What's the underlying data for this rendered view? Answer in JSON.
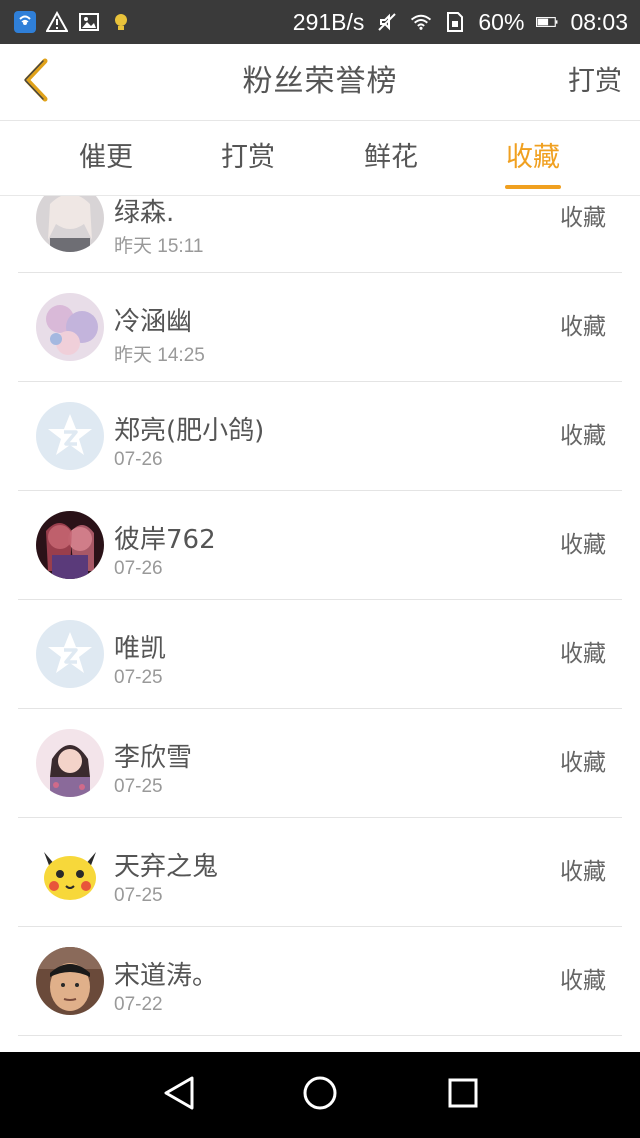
{
  "status_bar": {
    "speed": "291B/s",
    "battery": "60%",
    "time": "08:03"
  },
  "header": {
    "title": "粉丝荣誉榜",
    "right_action": "打赏"
  },
  "tabs": [
    {
      "label": "催更"
    },
    {
      "label": "打赏"
    },
    {
      "label": "鲜花"
    },
    {
      "label": "收藏",
      "active": true
    }
  ],
  "colors": {
    "accent": "#f0a020",
    "status_bar_bg": "#3a3a3a",
    "divider": "#e4e4e4"
  },
  "list": [
    {
      "name": "绿森.",
      "date": "昨天 15:11",
      "action": "收藏",
      "avatar": "photo-girl-icon"
    },
    {
      "name": "冷涵幽",
      "date": "昨天 14:25",
      "action": "收藏",
      "avatar": "anime-art-icon"
    },
    {
      "name": "郑亮(肥小鸽)",
      "date": "07-26",
      "action": "收藏",
      "avatar": "default-qq-star-icon"
    },
    {
      "name": "彼岸762",
      "date": "07-26",
      "action": "收藏",
      "avatar": "anime-girls-icon"
    },
    {
      "name": "唯凯",
      "date": "07-25",
      "action": "收藏",
      "avatar": "default-qq-star-icon"
    },
    {
      "name": "李欣雪",
      "date": "07-25",
      "action": "收藏",
      "avatar": "photo-girl-icon"
    },
    {
      "name": "天弃之鬼",
      "date": "07-25",
      "action": "收藏",
      "avatar": "pikachu-icon"
    },
    {
      "name": "宋道涛。",
      "date": "07-22",
      "action": "收藏",
      "avatar": "photo-man-icon"
    }
  ]
}
